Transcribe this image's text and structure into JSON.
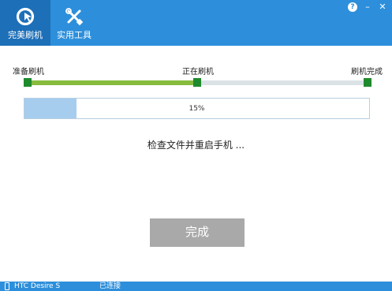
{
  "tabs": [
    {
      "label": "完美刷机",
      "icon": "flash-refresh-icon",
      "active": true
    },
    {
      "label": "实用工具",
      "icon": "tools-icon",
      "active": false
    }
  ],
  "window_controls": {
    "help": "?",
    "minimize": "–",
    "close": "✕"
  },
  "stages": {
    "items": [
      {
        "label": "准备刷机"
      },
      {
        "label": "正在刷机"
      },
      {
        "label": "刷机完成"
      }
    ],
    "fill_fraction": 0.5
  },
  "progress": {
    "percent_text": "15%",
    "value": 0.15
  },
  "status_message": "检查文件并重启手机 ...",
  "done_button_label": "完成",
  "statusbar": {
    "device_name": "HTC Desire S",
    "connection_status": "已连接"
  },
  "colors": {
    "header": "#2d8fdb",
    "active_tab": "#1d6fb8",
    "stage_fill": "#86bb3e",
    "stage_node": "#1f8a2d",
    "progress_fill": "#a6cdee",
    "done_button": "#a9a9a9"
  }
}
